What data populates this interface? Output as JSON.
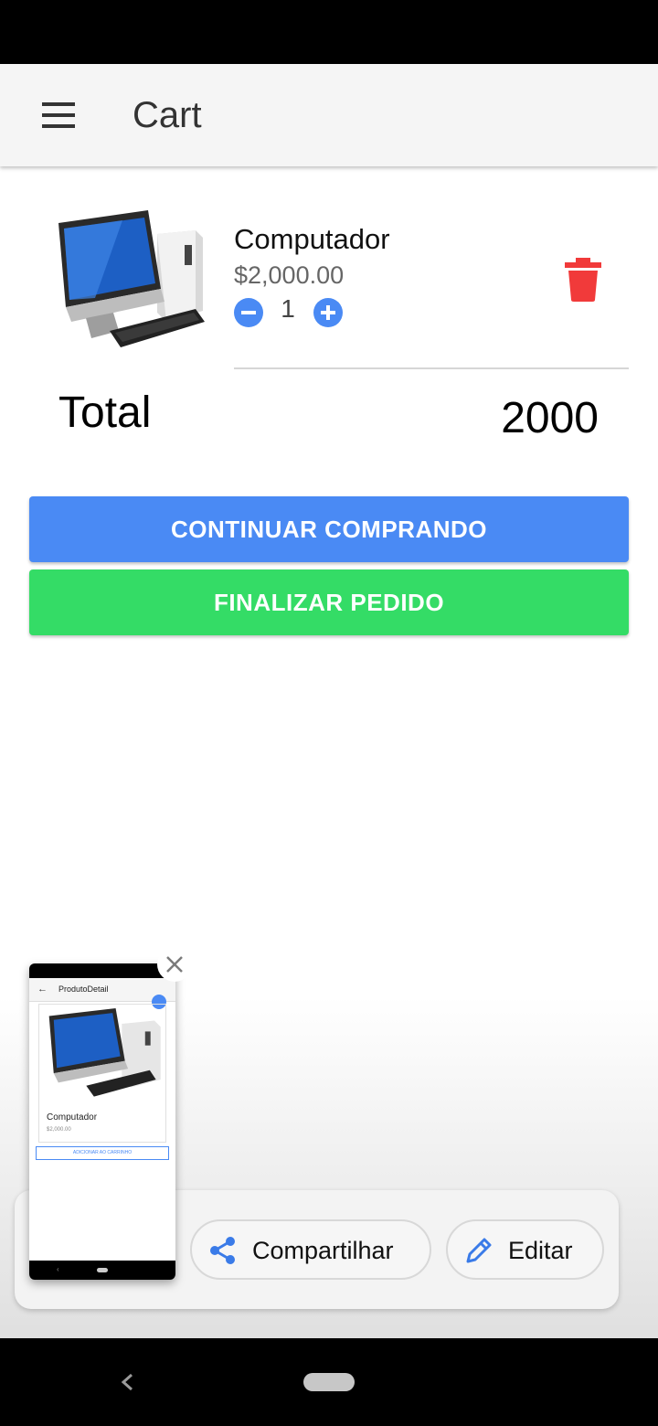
{
  "app_bar": {
    "title": "Cart",
    "menu_icon": "menu-icon"
  },
  "cart": {
    "items": [
      {
        "name": "Computador",
        "price": "$2,000.00",
        "quantity": "1"
      }
    ],
    "total_label": "Total",
    "total_value": "2000"
  },
  "buttons": {
    "continue_label": "CONTINUAR COMPRANDO",
    "finish_label": "FINALIZAR PEDIDO"
  },
  "share_panel": {
    "share_label": "Compartilhar",
    "edit_label": "Editar"
  },
  "thumbnail": {
    "title": "ProdutoDetail",
    "product_name": "Computador",
    "price": "$2,000.00",
    "add_button": "ADICIONAR AO CARRINHO"
  },
  "colors": {
    "primary_blue": "#4a8af4",
    "success_green": "#34dc66",
    "delete_red": "#f13a3a"
  }
}
